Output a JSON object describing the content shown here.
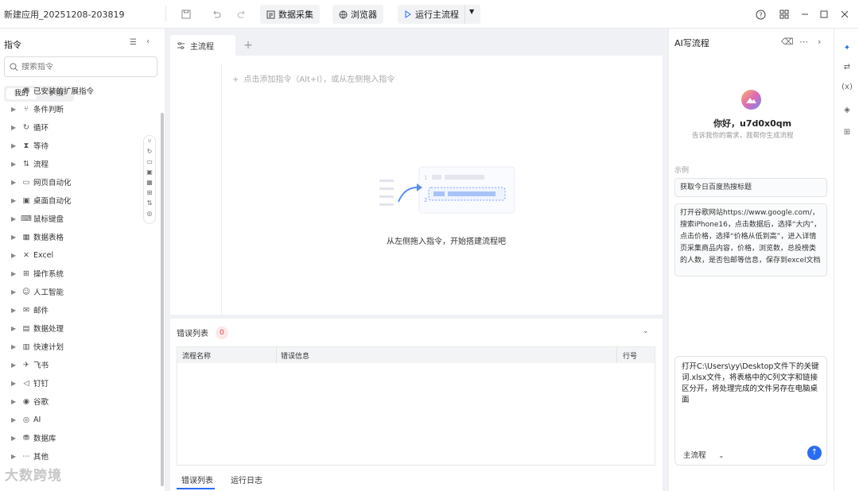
{
  "app": {
    "title": "新建应用_20251208-203819"
  },
  "toolbar": {
    "data_collect": "数据采集",
    "browser": "浏览器",
    "run_main": "运行主流程"
  },
  "sidebar": {
    "title": "指令",
    "search_placeholder": "搜索指令",
    "segments": {
      "mine": "我的",
      "ext": "扩展"
    },
    "installed_ext": "已安装的扩展指令",
    "items": [
      {
        "label": "条件判断",
        "icon": "branch-icon"
      },
      {
        "label": "循环",
        "icon": "loop-icon"
      },
      {
        "label": "等待",
        "icon": "hourglass-icon"
      },
      {
        "label": "流程",
        "icon": "flow-icon"
      },
      {
        "label": "网页自动化",
        "icon": "webpage-icon"
      },
      {
        "label": "桌面自动化",
        "icon": "desktop-icon"
      },
      {
        "label": "鼠标键盘",
        "icon": "keyboard-icon"
      },
      {
        "label": "数据表格",
        "icon": "table-icon"
      },
      {
        "label": "Excel",
        "icon": "excel-icon"
      },
      {
        "label": "操作系统",
        "icon": "os-icon"
      },
      {
        "label": "人工智能",
        "icon": "human-icon"
      },
      {
        "label": "邮件",
        "icon": "mail-icon"
      },
      {
        "label": "数据处理",
        "icon": "data-icon"
      },
      {
        "label": "快速计划",
        "icon": "plan-icon"
      },
      {
        "label": "飞书",
        "icon": "feishu-icon"
      },
      {
        "label": "钉钉",
        "icon": "dingtalk-icon"
      },
      {
        "label": "谷歌",
        "icon": "google-icon"
      },
      {
        "label": "AI",
        "icon": "ai-icon"
      },
      {
        "label": "数据库",
        "icon": "database-icon"
      },
      {
        "label": "其他",
        "icon": "other-icon"
      }
    ]
  },
  "editor": {
    "tab": "主流程",
    "hint": "点击添加指令（Alt+I），或从左侧拖入指令",
    "empty": "从左侧拖入指令，开始搭建流程吧"
  },
  "errors": {
    "title": "错误列表",
    "count": "0",
    "columns": [
      "流程名称",
      "错误信息",
      "行号"
    ],
    "bottom_tabs": [
      "错误列表",
      "运行日志"
    ]
  },
  "ai": {
    "title": "AI写流程",
    "greeting": "你好，u7d0x0qm",
    "subtitle": "告诉我你的需求，我帮你生成流程",
    "example_label": "示例",
    "example1": "获取今日百度热搜标题",
    "example2": "打开谷歌网站https://www.google.com/，搜索iPhone16，点击数据后，选择“大内”，点击价格，选择“价格从低到高”，进入详情页采集商品内容，价格，浏览数，总投榜类的人数，是否包邮等信息，保存到excel文档",
    "input_text": "打开C:\\Users\\yy\\Desktop文件下的关键词.xlsx文件，将表格中的C列文字和链接区分开，将处理完成的文件另存在电脑桌面",
    "flow_select": "主流程"
  },
  "watermark": "大数跨境"
}
